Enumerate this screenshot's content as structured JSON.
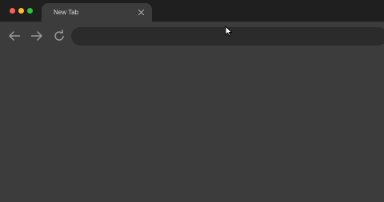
{
  "window": {
    "controls": [
      "close",
      "minimize",
      "maximize"
    ]
  },
  "tab": {
    "title": "New Tab",
    "close_icon": "close-icon"
  },
  "toolbar": {
    "back_icon": "arrow-left-icon",
    "forward_icon": "arrow-right-icon",
    "reload_icon": "reload-icon"
  },
  "omnibox": {
    "value": "",
    "placeholder": ""
  },
  "colors": {
    "titlebar": "#1f1f1f",
    "tab": "#3c3c3c",
    "toolbar": "#3c3c3c",
    "omnibox": "#2b2b2b",
    "traffic_close": "#ff5f57",
    "traffic_minimize": "#febc2e",
    "traffic_maximize": "#28c840"
  }
}
